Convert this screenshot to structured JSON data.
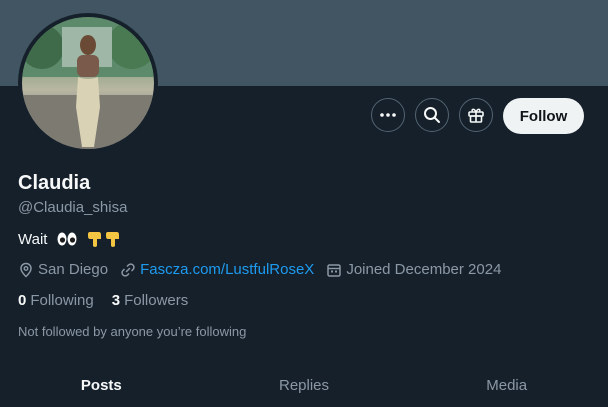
{
  "profile": {
    "name": "Claudia",
    "handle": "@Claudia_shisa",
    "bio_text": "Wait",
    "bio_emojis": [
      "eyes-emoji",
      "pointing-down-emoji",
      "pointing-down-emoji"
    ],
    "location": "San Diego",
    "website": "Fascza.com/LustfulRoseX",
    "joined": "Joined December 2024",
    "following_count": "0",
    "following_label": "Following",
    "followers_count": "3",
    "followers_label": "Followers",
    "not_followed_text": "Not followed by anyone you’re following"
  },
  "actions": {
    "more_icon": "more-icon",
    "search_icon": "search-icon",
    "gift_icon": "gift-icon",
    "follow_label": "Follow"
  },
  "tabs": [
    {
      "label": "Posts",
      "active": true
    },
    {
      "label": "Replies",
      "active": false
    },
    {
      "label": "Media",
      "active": false
    }
  ],
  "colors": {
    "background": "#15202b",
    "banner": "#425563",
    "link": "#1d9bf0",
    "secondary_text": "#8b98a5",
    "follow_button": "#eff3f4"
  }
}
